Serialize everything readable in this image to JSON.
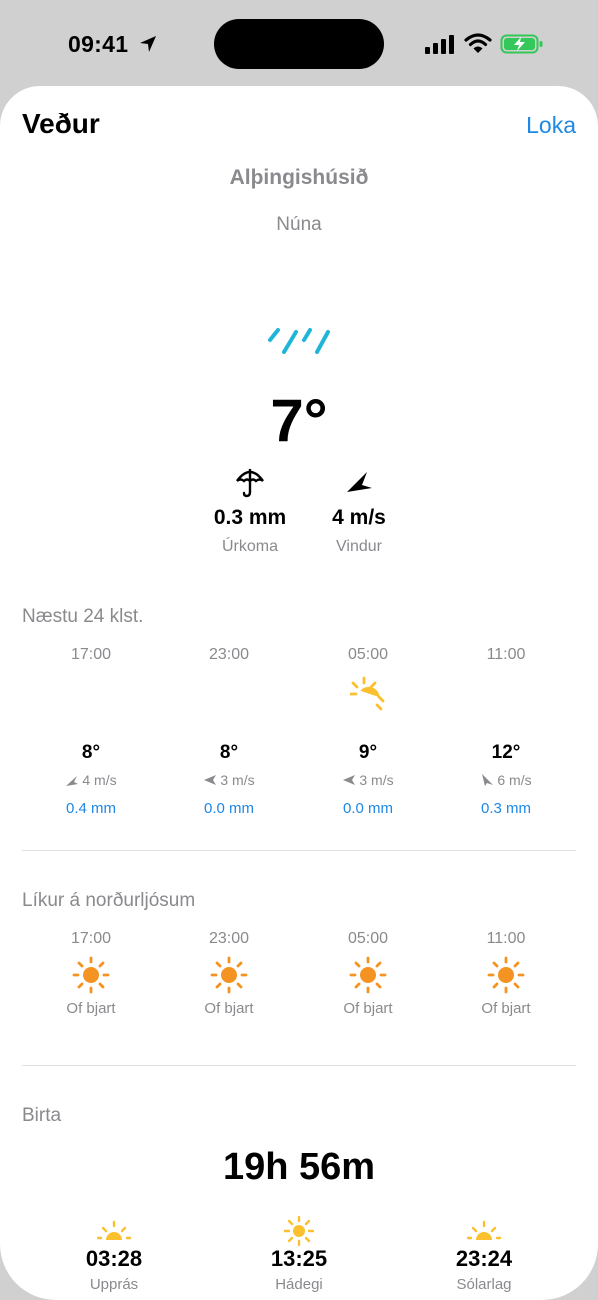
{
  "status_bar": {
    "time": "09:41"
  },
  "header": {
    "title": "Veður",
    "close_label": "Loka"
  },
  "location": "Alþingishúsið",
  "now_label": "Núna",
  "current": {
    "condition_icon": "rain-icon",
    "temperature": "7°",
    "precipitation": {
      "value": "0.3 mm",
      "label": "Úrkoma",
      "icon": "umbrella-icon"
    },
    "wind": {
      "value": "4 m/s",
      "label": "Vindur",
      "icon": "wind-arrow-icon"
    }
  },
  "forecast": {
    "title": "Næstu 24 klst.",
    "items": [
      {
        "hour": "17:00",
        "temp": "8°",
        "wind": "4 m/s",
        "precip": "0.4 mm",
        "icon": "none"
      },
      {
        "hour": "23:00",
        "temp": "8°",
        "wind": "3 m/s",
        "precip": "0.0 mm",
        "icon": "none"
      },
      {
        "hour": "05:00",
        "temp": "9°",
        "wind": "3 m/s",
        "precip": "0.0 mm",
        "icon": "partly-sunny-icon"
      },
      {
        "hour": "11:00",
        "temp": "12°",
        "wind": "6 m/s",
        "precip": "0.3 mm",
        "icon": "none"
      }
    ]
  },
  "aurora": {
    "title": "Líkur á norðurljósum",
    "items": [
      {
        "hour": "17:00",
        "status": "Of bjart"
      },
      {
        "hour": "23:00",
        "status": "Of bjart"
      },
      {
        "hour": "05:00",
        "status": "Of bjart"
      },
      {
        "hour": "11:00",
        "status": "Of bjart"
      }
    ]
  },
  "daylight": {
    "title": "Birta",
    "length": "19h 56m",
    "sunrise": {
      "time": "03:28",
      "label": "Upprás"
    },
    "noon": {
      "time": "13:25",
      "label": "Hádegi"
    },
    "sunset": {
      "time": "23:24",
      "label": "Sólarlag"
    }
  },
  "colors": {
    "accent": "#1e88e5",
    "rain": "#1fb5d9",
    "sun_orange": "#f59322",
    "sun_yellow": "#fbc02d",
    "battery": "#34c759"
  }
}
